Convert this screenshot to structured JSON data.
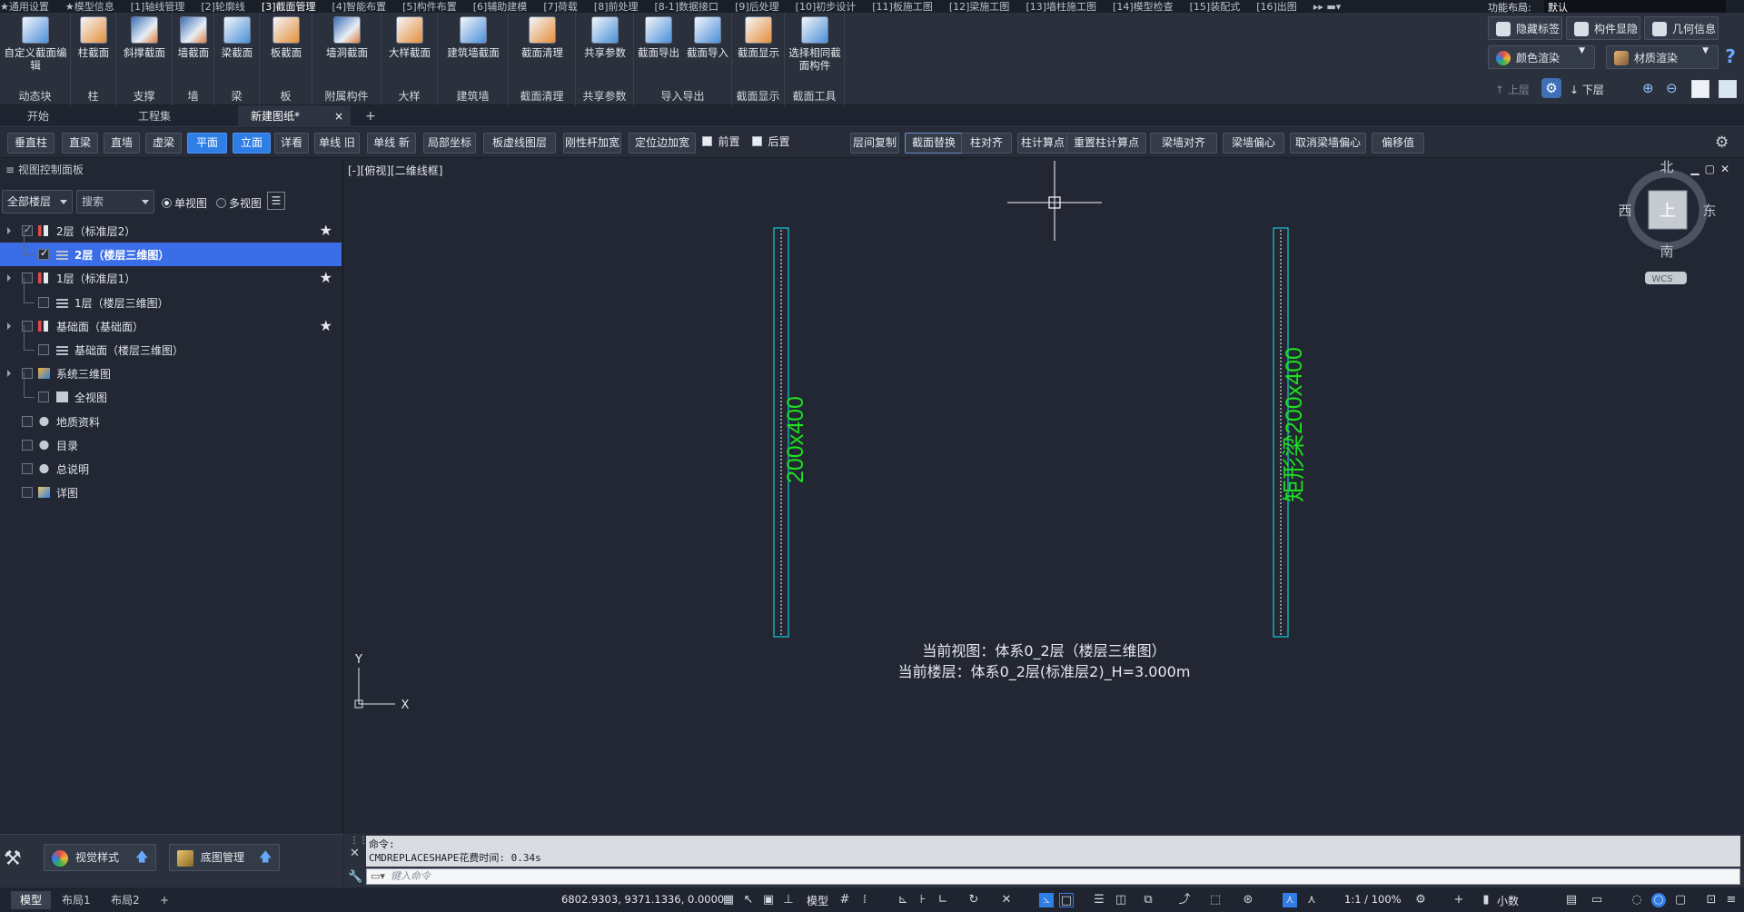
{
  "menubar": {
    "tabs": [
      "★通用设置",
      "★模型信息",
      "[1]轴线管理",
      "[2]轮廓线",
      "[3]截面管理",
      "[4]智能布置",
      "[5]构件布置",
      "[6]辅助建模",
      "[7]荷载",
      "[8]前处理",
      "[8-1]数据接口",
      "[9]后处理",
      "[10]初步设计",
      "[11]板施工图",
      "[12]梁施工图",
      "[13]墙柱施工图",
      "[14]模型检查",
      "[15]装配式",
      "[16]出图"
    ],
    "active_tab": "[3]截面管理",
    "layout_label": "功能布局:",
    "layout_value": "默认"
  },
  "ribbon": {
    "groups": [
      {
        "label": "动态块",
        "buttons": [
          "自定义截面编辑"
        ]
      },
      {
        "label": "柱",
        "buttons": [
          "柱截面"
        ]
      },
      {
        "label": "支撑",
        "buttons": [
          "斜撑截面"
        ]
      },
      {
        "label": "墙",
        "buttons": [
          "墙截面"
        ]
      },
      {
        "label": "梁",
        "buttons": [
          "梁截面"
        ]
      },
      {
        "label": "板",
        "buttons": [
          "板截面"
        ]
      },
      {
        "label": "附属构件",
        "buttons": [
          "墙洞截面"
        ]
      },
      {
        "label": "大样",
        "buttons": [
          "大样截面"
        ]
      },
      {
        "label": "建筑墙",
        "buttons": [
          "建筑墙截面"
        ]
      },
      {
        "label": "截面清理",
        "buttons": [
          "截面清理"
        ]
      },
      {
        "label": "共享参数",
        "buttons": [
          "共享参数"
        ]
      },
      {
        "label": "导入导出",
        "buttons": [
          "截面导出",
          "截面导入"
        ]
      },
      {
        "label": "截面显示",
        "buttons": [
          "截面显示"
        ]
      },
      {
        "label": "截面工具",
        "buttons": [
          "选择相同截面构件"
        ]
      }
    ],
    "right": {
      "hide_tag": "隐藏标签",
      "component_show": "构件显隐",
      "geometry_info": "几何信息",
      "color_render": "颜色渲染",
      "material_render": "材质渲染",
      "upper_floor": "上层",
      "lower_floor": "下层",
      "help": "?"
    }
  },
  "doctabs": [
    "开始",
    "工程集",
    "新建图纸*"
  ],
  "doctabs_close": "×",
  "doctabs_add": "+",
  "toolbar": {
    "buttons": [
      "垂直柱",
      "直梁",
      "直墙",
      "虚梁",
      "平面",
      "立面",
      "详看",
      "单线 旧",
      "单线 新",
      "局部坐标",
      "板虚线图层",
      "刚性杆加宽",
      "定位边加宽",
      "前置",
      "后置",
      "层间复制",
      "截面替换",
      "柱对齐",
      "柱计算点",
      "重置柱计算点",
      "梁墙对齐",
      "梁墙偏心",
      "取消梁墙偏心",
      "偏移值"
    ],
    "selected": [
      "平面",
      "立面"
    ]
  },
  "panel": {
    "title": "视图控制面板",
    "floor_select": "全部楼层",
    "search_placeholder": "搜索",
    "single_view": "单视图",
    "multi_view": "多视图",
    "tree": [
      {
        "label": "2层（标准层2）",
        "level": 0,
        "checked": true,
        "star": true
      },
      {
        "label": "2层（楼层三维图）",
        "level": 1,
        "checked": true,
        "selected": true
      },
      {
        "label": "1层（标准层1）",
        "level": 0,
        "checked": false,
        "star": true
      },
      {
        "label": "1层（楼层三维图）",
        "level": 1,
        "checked": false
      },
      {
        "label": "基础面（基础面）",
        "level": 0,
        "checked": false,
        "star": true
      },
      {
        "label": "基础面（楼层三维图）",
        "level": 1,
        "checked": false
      },
      {
        "label": "系统三维图",
        "level": 0,
        "checked": false
      },
      {
        "label": "全视图",
        "level": 1,
        "checked": false
      },
      {
        "label": "地质资料",
        "level": 0,
        "checked": false
      },
      {
        "label": "目录",
        "level": 0,
        "checked": false
      },
      {
        "label": "总说明",
        "level": 0,
        "checked": false
      },
      {
        "label": "详图",
        "level": 0,
        "checked": false
      }
    ],
    "visual_style": "视觉样式",
    "base_map": "底图管理"
  },
  "viewport": {
    "header": "[-][俯视][二维线框]",
    "beam_left_label": "200x400",
    "beam_right_label": "矩形梁200x400",
    "compass": {
      "north": "北",
      "south": "南",
      "east": "东",
      "west": "西",
      "center": "上",
      "wcs": "WCS"
    },
    "axis_y": "Y",
    "axis_x": "X",
    "current_view": "当前视图：体系0_2层（楼层三维图）",
    "current_floor": "当前楼层：体系0_2层(标准层2)_H=3.000m",
    "colors": {
      "beam_outline": "#17c9d6",
      "beam_text": "#1fe01f",
      "crosshair": "#ffffff"
    }
  },
  "command": {
    "line1": "命令:",
    "line2": "CMDREPLACESHAPE花费时间: 0.34s",
    "input_placeholder": "键入命令"
  },
  "status": {
    "tabs": [
      "模型",
      "布局1",
      "布局2"
    ],
    "add": "+",
    "coords": "6802.9303, 9371.1336, 0.0000",
    "model": "模型",
    "scale": "1:1 / 100%",
    "decimal": "小数"
  }
}
